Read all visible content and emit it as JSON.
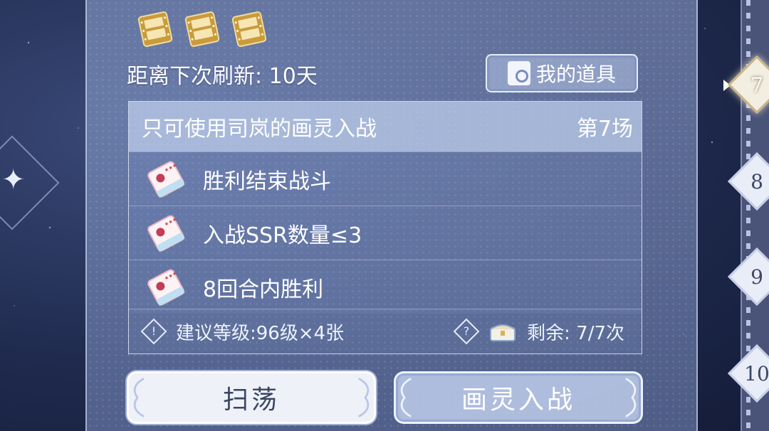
{
  "header": {
    "refresh_text": "距离下次刷新: 10天",
    "items_button": "我的道具"
  },
  "stage": {
    "condition": "只可使用司岚的画灵入战",
    "number_label": "第7场",
    "objectives": [
      "胜利结束战斗",
      "入战SSR数量≤3",
      "8回合内胜利"
    ],
    "recommend": "建议等级:96级×4张",
    "remaining": "剩余: 7/7次"
  },
  "buttons": {
    "sweep": "扫荡",
    "enter": "画灵入战"
  },
  "stage_nav": [
    "7",
    "8",
    "9",
    "10"
  ],
  "current_stage_index": 0,
  "colors": {
    "panel": "#8c9ccd",
    "gold": "#d8b25a"
  }
}
